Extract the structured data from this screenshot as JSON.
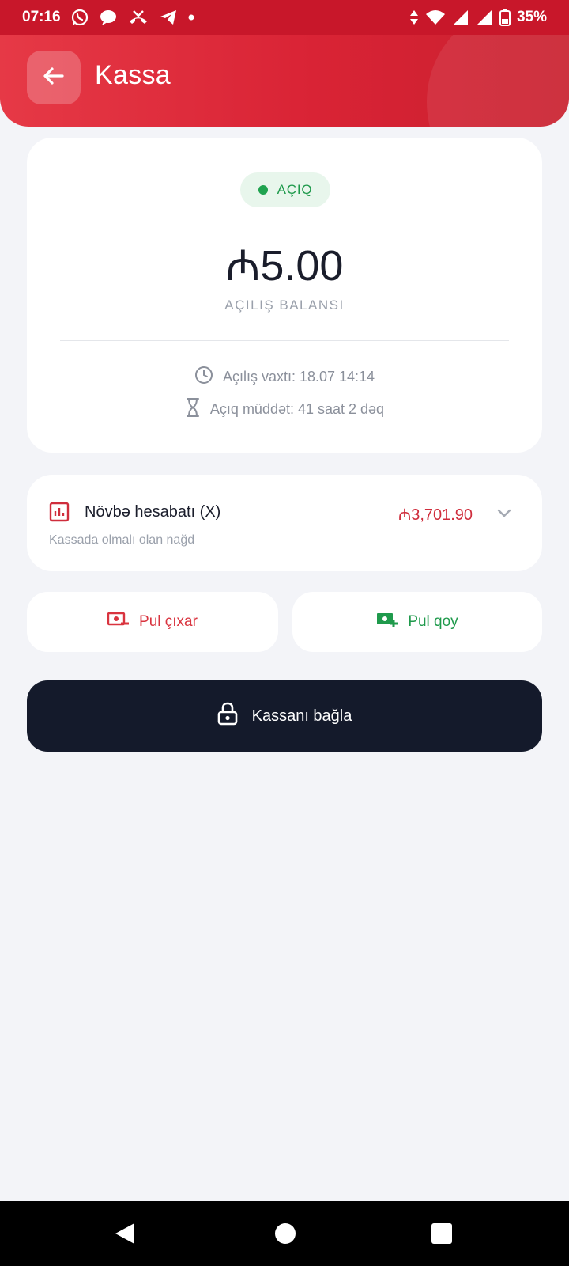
{
  "status_bar": {
    "time": "07:16",
    "battery": "35%",
    "icons": [
      "whatsapp-icon",
      "chat-icon",
      "missed-call-icon",
      "telegram-icon",
      "dot-icon",
      "data-arrows-icon",
      "wifi-icon",
      "signal-icon",
      "signal-icon",
      "battery-icon"
    ]
  },
  "app_bar": {
    "title": "Kassa",
    "back_icon": "arrow-left-icon"
  },
  "register": {
    "status": "AÇIQ",
    "status_color": "#1fa34f",
    "balance": "₼5.00",
    "balance_label": "AÇILIŞ BALANSI",
    "opened_at": "Açılış vaxtı: 18.07 14:14",
    "open_duration": "Açıq müddət: 41 saat 2 dəq"
  },
  "report": {
    "title": "Növbə hesabatı (X)",
    "subtitle": "Kassada olmalı olan nağd",
    "amount": "₼3,701.90",
    "amount_color": "#cf2d3c"
  },
  "actions": {
    "withdraw_label": "Pul çıxar",
    "deposit_label": "Pul qoy",
    "close_label": "Kassanı bağla"
  },
  "colors": {
    "brand": "#e63946",
    "dark_button": "#141a2b",
    "background": "#f3f4f8"
  }
}
